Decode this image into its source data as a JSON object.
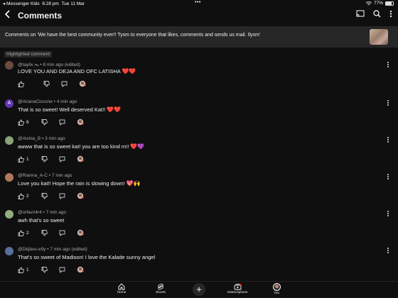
{
  "status_bar": {
    "back_app": "◂ Messenger Kids",
    "time": "6:28 pm",
    "date": "Tue 11 Mar",
    "battery": "77%"
  },
  "header": {
    "title": "Comments"
  },
  "context": {
    "text": "Comments on 'We have the best community ever!! Tysm to everyone that likes, comments and sends us mail. Ilysm'"
  },
  "highlighted_label": "Highlighted comment",
  "comments": [
    {
      "author": "@taylix.ᯓ • 8 min ago (edited)",
      "text": "LOVE YOU AND DEJA AND OFC LATISHA",
      "emoji": "❤️❤️",
      "likes": "",
      "avatar_color": "#6b4b3e"
    },
    {
      "author": "@ArianaCiccone • 4 min ago",
      "text": "That is so sweet! Well deserved Kat!!",
      "emoji": "❤️❤️",
      "likes": "6",
      "avatar_color": "#5e35b1",
      "avatar_letter": "A"
    },
    {
      "author": "@Aishia_B • 3 min ago",
      "text": "awww that is so sweet kat! you are too kind m!!",
      "emoji": "❤️💜",
      "likes": "1",
      "avatar_color": "#8aa37a"
    },
    {
      "author": "@Rianna_A-C • 7 min ago",
      "text": "Love you kat!! Hope the rain is slowing down!",
      "emoji": "💖🙌",
      "likes": "2",
      "avatar_color": "#b07a5a"
    },
    {
      "author": "@urfavz4r4 • 7 min ago",
      "text": "awh that's so sweet",
      "emoji": "",
      "likes": "2",
      "avatar_color": "#8fae7c"
    },
    {
      "author": "@Déjàvu-e9y • 7 min ago (edited)",
      "text": "That's so sweet of Madison! I love the Kalade sunny angel",
      "emoji": "",
      "likes": "1",
      "avatar_color": "#5b6f9c"
    }
  ],
  "bottom_nav": {
    "home": "Home",
    "shorts": "Shorts",
    "subscriptions": "Subscriptions",
    "you": "You"
  },
  "icons": [
    "back-arrow-icon",
    "cast-icon",
    "search-icon",
    "more-vert-icon",
    "thumbs-up-icon",
    "thumbs-down-icon",
    "reply-icon",
    "creator-heart-icon",
    "home-icon",
    "shorts-icon",
    "plus-icon",
    "subscriptions-icon"
  ]
}
